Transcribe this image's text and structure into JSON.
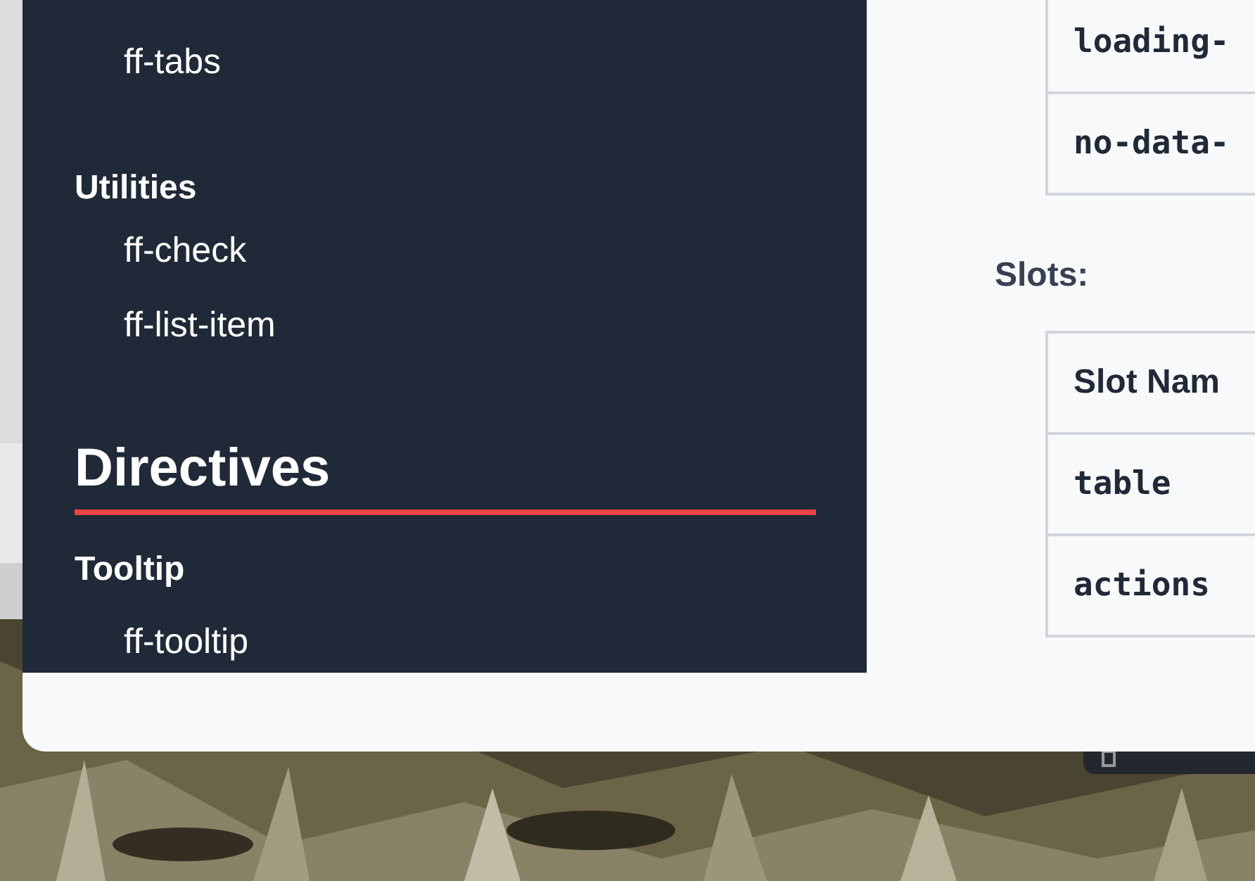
{
  "sidebar": {
    "sections": [
      {
        "kind": "group",
        "items": [
          {
            "label": "ff-tabs"
          }
        ]
      },
      {
        "kind": "group",
        "title": "Utilities",
        "items": [
          {
            "label": "ff-check"
          },
          {
            "label": "ff-list-item"
          }
        ]
      },
      {
        "kind": "heading",
        "title": "Directives"
      },
      {
        "kind": "group",
        "title": "Tooltip",
        "items": [
          {
            "label": "ff-tooltip"
          }
        ]
      }
    ]
  },
  "main": {
    "events_table": {
      "rows": [
        [
          "loading-"
        ],
        [
          "no-data-"
        ]
      ]
    },
    "slots_label": "Slots:",
    "slots_table": {
      "columns": [
        "Slot Nam"
      ],
      "rows": [
        [
          "table"
        ],
        [
          "actions"
        ]
      ]
    }
  }
}
